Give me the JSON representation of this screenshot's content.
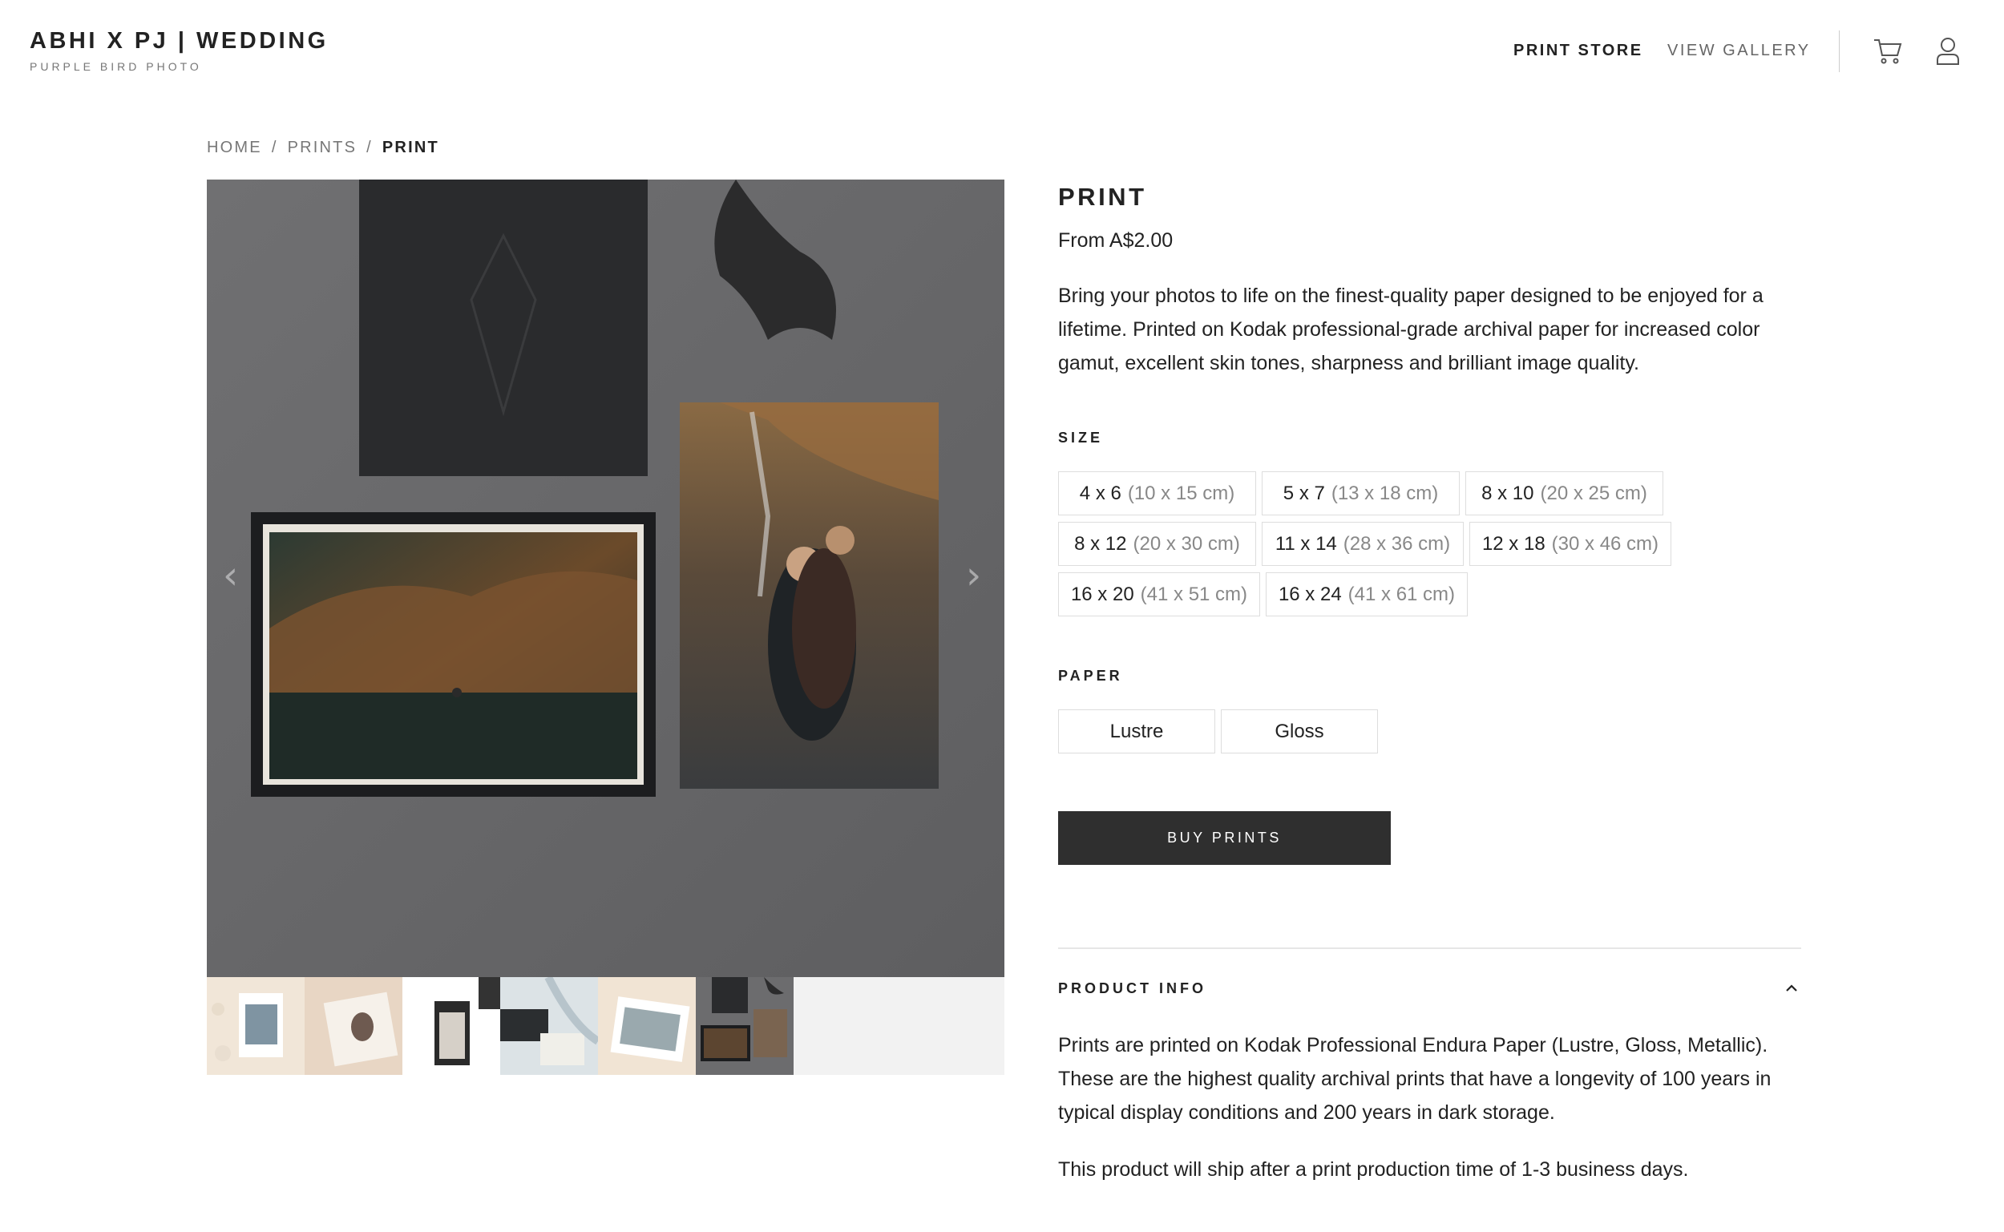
{
  "header": {
    "brand_title": "ABHI X PJ | WEDDING",
    "brand_subtitle": "PURPLE BIRD PHOTO",
    "nav": [
      "PRINT STORE",
      "VIEW GALLERY"
    ],
    "icons": [
      "cart-icon",
      "user-icon"
    ]
  },
  "breadcrumb": {
    "items": [
      "HOME",
      "PRINTS",
      "PRINT"
    ],
    "separator": "/"
  },
  "gallery": {
    "prev_glyph": "‹",
    "next_glyph": "›",
    "thumbnail_count": 6,
    "selected_thumbnail": 6
  },
  "product": {
    "title": "PRINT",
    "price": "From A$2.00",
    "description": "Bring your photos to life on the finest-quality paper designed to be enjoyed for a lifetime. Printed on Kodak professional-grade archival paper for increased color gamut, excellent skin tones, sharpness and brilliant image quality.",
    "size_label": "SIZE",
    "sizes": [
      {
        "imperial": "4 x 6",
        "metric": "(10 x 15 cm)"
      },
      {
        "imperial": "5 x 7",
        "metric": "(13 x 18 cm)"
      },
      {
        "imperial": "8 x 10",
        "metric": "(20 x 25 cm)"
      },
      {
        "imperial": "8 x 12",
        "metric": "(20 x 30 cm)"
      },
      {
        "imperial": "11 x 14",
        "metric": "(28 x 36 cm)"
      },
      {
        "imperial": "12 x 18",
        "metric": "(30 x 46 cm)"
      },
      {
        "imperial": "16 x 20",
        "metric": "(41 x 51 cm)"
      },
      {
        "imperial": "16 x 24",
        "metric": "(41 x 61 cm)"
      }
    ],
    "paper_label": "PAPER",
    "papers": [
      "Lustre",
      "Gloss"
    ],
    "buy_label": "BUY PRINTS"
  },
  "product_info": {
    "heading": "PRODUCT INFO",
    "paragraphs": [
      "Prints are printed on Kodak Professional Endura Paper (Lustre, Gloss, Metallic). These are the highest quality archival prints that have a longevity of 100 years in typical display conditions and 200 years in dark storage.",
      "This product will ship after a print production time of 1-3 business days."
    ]
  },
  "colors": {
    "button_bg": "#2f2f2f",
    "option_border": "#dddddd",
    "muted_text": "#888888"
  }
}
